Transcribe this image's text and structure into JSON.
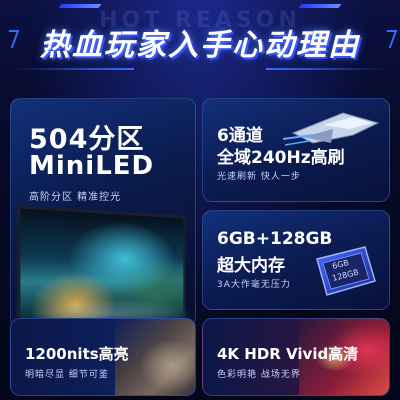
{
  "header": {
    "headline": "热血玩家入手心动理由",
    "watermark": "HOT REASON"
  },
  "card_big": {
    "title_line1": "504分区",
    "title_line2": "MiniLED",
    "subtitle": "高阶分区 精准控光"
  },
  "card_channels": {
    "title_line1": "6通道",
    "title_line2": "全域240Hz高刷",
    "subtitle": "光速刷新 快人一步"
  },
  "card_memory": {
    "title_line1": "6GB+128GB",
    "title_line2": "超大内存",
    "subtitle": "3A大作毫无压力",
    "chip_label_1": "6GB",
    "chip_label_2": "128GB"
  },
  "card_brightness": {
    "title": "1200nits高亮",
    "subtitle": "明暗尽显 细节可鉴"
  },
  "card_hdr": {
    "title": "4K HDR Vivid高清",
    "subtitle": "色彩明艳 战场无界"
  },
  "colors": {
    "background": "#05081c",
    "accent": "#3a6cff",
    "card": "#12307a"
  }
}
